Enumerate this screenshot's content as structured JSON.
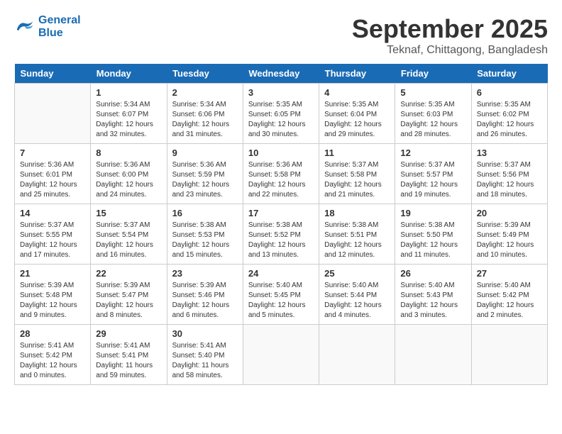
{
  "header": {
    "logo_line1": "General",
    "logo_line2": "Blue",
    "title": "September 2025",
    "subtitle": "Teknaf, Chittagong, Bangladesh"
  },
  "weekdays": [
    "Sunday",
    "Monday",
    "Tuesday",
    "Wednesday",
    "Thursday",
    "Friday",
    "Saturday"
  ],
  "weeks": [
    [
      {
        "day": "",
        "info": ""
      },
      {
        "day": "1",
        "info": "Sunrise: 5:34 AM\nSunset: 6:07 PM\nDaylight: 12 hours\nand 32 minutes."
      },
      {
        "day": "2",
        "info": "Sunrise: 5:34 AM\nSunset: 6:06 PM\nDaylight: 12 hours\nand 31 minutes."
      },
      {
        "day": "3",
        "info": "Sunrise: 5:35 AM\nSunset: 6:05 PM\nDaylight: 12 hours\nand 30 minutes."
      },
      {
        "day": "4",
        "info": "Sunrise: 5:35 AM\nSunset: 6:04 PM\nDaylight: 12 hours\nand 29 minutes."
      },
      {
        "day": "5",
        "info": "Sunrise: 5:35 AM\nSunset: 6:03 PM\nDaylight: 12 hours\nand 28 minutes."
      },
      {
        "day": "6",
        "info": "Sunrise: 5:35 AM\nSunset: 6:02 PM\nDaylight: 12 hours\nand 26 minutes."
      }
    ],
    [
      {
        "day": "7",
        "info": "Sunrise: 5:36 AM\nSunset: 6:01 PM\nDaylight: 12 hours\nand 25 minutes."
      },
      {
        "day": "8",
        "info": "Sunrise: 5:36 AM\nSunset: 6:00 PM\nDaylight: 12 hours\nand 24 minutes."
      },
      {
        "day": "9",
        "info": "Sunrise: 5:36 AM\nSunset: 5:59 PM\nDaylight: 12 hours\nand 23 minutes."
      },
      {
        "day": "10",
        "info": "Sunrise: 5:36 AM\nSunset: 5:58 PM\nDaylight: 12 hours\nand 22 minutes."
      },
      {
        "day": "11",
        "info": "Sunrise: 5:37 AM\nSunset: 5:58 PM\nDaylight: 12 hours\nand 21 minutes."
      },
      {
        "day": "12",
        "info": "Sunrise: 5:37 AM\nSunset: 5:57 PM\nDaylight: 12 hours\nand 19 minutes."
      },
      {
        "day": "13",
        "info": "Sunrise: 5:37 AM\nSunset: 5:56 PM\nDaylight: 12 hours\nand 18 minutes."
      }
    ],
    [
      {
        "day": "14",
        "info": "Sunrise: 5:37 AM\nSunset: 5:55 PM\nDaylight: 12 hours\nand 17 minutes."
      },
      {
        "day": "15",
        "info": "Sunrise: 5:37 AM\nSunset: 5:54 PM\nDaylight: 12 hours\nand 16 minutes."
      },
      {
        "day": "16",
        "info": "Sunrise: 5:38 AM\nSunset: 5:53 PM\nDaylight: 12 hours\nand 15 minutes."
      },
      {
        "day": "17",
        "info": "Sunrise: 5:38 AM\nSunset: 5:52 PM\nDaylight: 12 hours\nand 13 minutes."
      },
      {
        "day": "18",
        "info": "Sunrise: 5:38 AM\nSunset: 5:51 PM\nDaylight: 12 hours\nand 12 minutes."
      },
      {
        "day": "19",
        "info": "Sunrise: 5:38 AM\nSunset: 5:50 PM\nDaylight: 12 hours\nand 11 minutes."
      },
      {
        "day": "20",
        "info": "Sunrise: 5:39 AM\nSunset: 5:49 PM\nDaylight: 12 hours\nand 10 minutes."
      }
    ],
    [
      {
        "day": "21",
        "info": "Sunrise: 5:39 AM\nSunset: 5:48 PM\nDaylight: 12 hours\nand 9 minutes."
      },
      {
        "day": "22",
        "info": "Sunrise: 5:39 AM\nSunset: 5:47 PM\nDaylight: 12 hours\nand 8 minutes."
      },
      {
        "day": "23",
        "info": "Sunrise: 5:39 AM\nSunset: 5:46 PM\nDaylight: 12 hours\nand 6 minutes."
      },
      {
        "day": "24",
        "info": "Sunrise: 5:40 AM\nSunset: 5:45 PM\nDaylight: 12 hours\nand 5 minutes."
      },
      {
        "day": "25",
        "info": "Sunrise: 5:40 AM\nSunset: 5:44 PM\nDaylight: 12 hours\nand 4 minutes."
      },
      {
        "day": "26",
        "info": "Sunrise: 5:40 AM\nSunset: 5:43 PM\nDaylight: 12 hours\nand 3 minutes."
      },
      {
        "day": "27",
        "info": "Sunrise: 5:40 AM\nSunset: 5:42 PM\nDaylight: 12 hours\nand 2 minutes."
      }
    ],
    [
      {
        "day": "28",
        "info": "Sunrise: 5:41 AM\nSunset: 5:42 PM\nDaylight: 12 hours\nand 0 minutes."
      },
      {
        "day": "29",
        "info": "Sunrise: 5:41 AM\nSunset: 5:41 PM\nDaylight: 11 hours\nand 59 minutes."
      },
      {
        "day": "30",
        "info": "Sunrise: 5:41 AM\nSunset: 5:40 PM\nDaylight: 11 hours\nand 58 minutes."
      },
      {
        "day": "",
        "info": ""
      },
      {
        "day": "",
        "info": ""
      },
      {
        "day": "",
        "info": ""
      },
      {
        "day": "",
        "info": ""
      }
    ]
  ]
}
